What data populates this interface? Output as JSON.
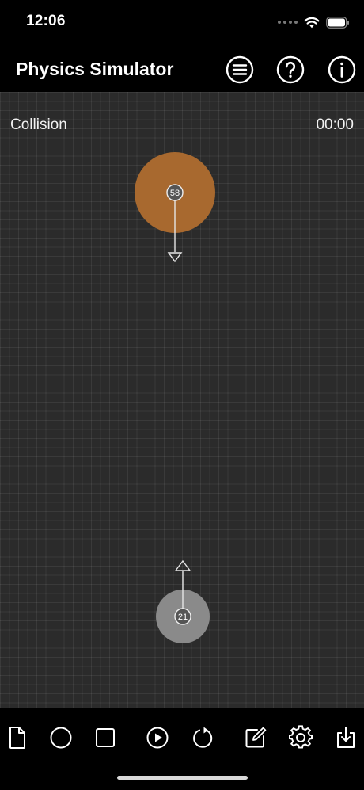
{
  "status_bar": {
    "time": "12:06",
    "icons": [
      "cellular-dots-icon",
      "wifi-icon",
      "battery-icon"
    ]
  },
  "nav": {
    "title": "Physics Simulator",
    "buttons": [
      {
        "name": "menu-button",
        "icon": "list-icon"
      },
      {
        "name": "help-button",
        "icon": "question-mark-icon"
      },
      {
        "name": "info-button",
        "icon": "info-icon"
      }
    ]
  },
  "simulation": {
    "scene_name": "Collision",
    "timer": "00:00",
    "bodies": [
      {
        "label": "58",
        "color": "#a8692f",
        "velocity_direction": "down"
      },
      {
        "label": "21",
        "color": "#8a8a8a",
        "velocity_direction": "up"
      }
    ]
  },
  "toolbar": {
    "buttons": [
      {
        "name": "new-document-button",
        "icon": "document-icon"
      },
      {
        "name": "add-circle-button",
        "icon": "circle-icon"
      },
      {
        "name": "add-square-button",
        "icon": "square-icon"
      },
      {
        "name": "play-button",
        "icon": "play-icon"
      },
      {
        "name": "reset-button",
        "icon": "rotate-icon"
      },
      {
        "name": "edit-button",
        "icon": "edit-icon"
      },
      {
        "name": "settings-button",
        "icon": "gear-icon"
      },
      {
        "name": "export-button",
        "icon": "download-icon"
      }
    ]
  },
  "colors": {
    "background": "#000000",
    "canvas": "#2b2b2b",
    "accent_orange": "#a8692f",
    "body_gray": "#8a8a8a"
  }
}
